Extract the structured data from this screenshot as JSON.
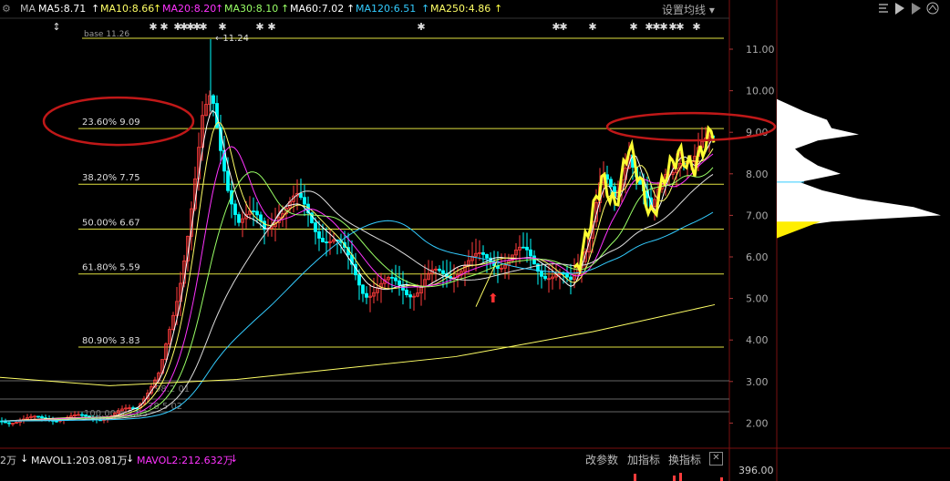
{
  "header": {
    "ma_prefix": "MA",
    "mas": [
      {
        "label": "MA5:8.71",
        "color": "#ffffff"
      },
      {
        "label": "MA10:8.66",
        "color": "#ffff66"
      },
      {
        "label": "MA20:8.20",
        "color": "#ff33ff"
      },
      {
        "label": "MA30:8.10",
        "color": "#99ff66"
      },
      {
        "label": "MA60:7.02",
        "color": "#ffffff"
      },
      {
        "label": "MA120:6.51",
        "color": "#33ccff"
      },
      {
        "label": "MA250:4.86",
        "color": "#ffff66"
      }
    ],
    "settings_label": "设置均线"
  },
  "base_label": "base  11.26",
  "high_label": "11.24",
  "fib_levels": [
    {
      "label": "23.60% 9.09",
      "value": 9.09
    },
    {
      "label": "38.20% 7.75",
      "value": 7.75
    },
    {
      "label": "50.00% 6.67",
      "value": 6.67
    },
    {
      "label": "61.80% 5.59",
      "value": 5.59
    },
    {
      "label": "80.90% 3.83",
      "value": 3.83
    }
  ],
  "lower_labels": [
    "98.2 01",
    "78.5 02",
    "100.00% 2.03"
  ],
  "price_axis": [
    "11.00",
    "10.00",
    "9.00",
    "8.00",
    "7.00",
    "6.00",
    "5.00",
    "4.00",
    "3.00",
    "2.00"
  ],
  "volume_bar": {
    "left_cut": "2万",
    "mavol1": "MAVOL1:203.081万",
    "mavol2": "MAVOL2:212.632万",
    "btn_params": "改参数",
    "btn_add": "加指标",
    "btn_switch": "换指标",
    "close": "✕",
    "axis_label": "396.00"
  },
  "colors": {
    "up": "#ff3c3c",
    "down": "#00ffff",
    "fib": "#e0e040",
    "circle": "#c01818",
    "profile": "#ffffff",
    "yellow_profile": "#ffee00"
  }
}
